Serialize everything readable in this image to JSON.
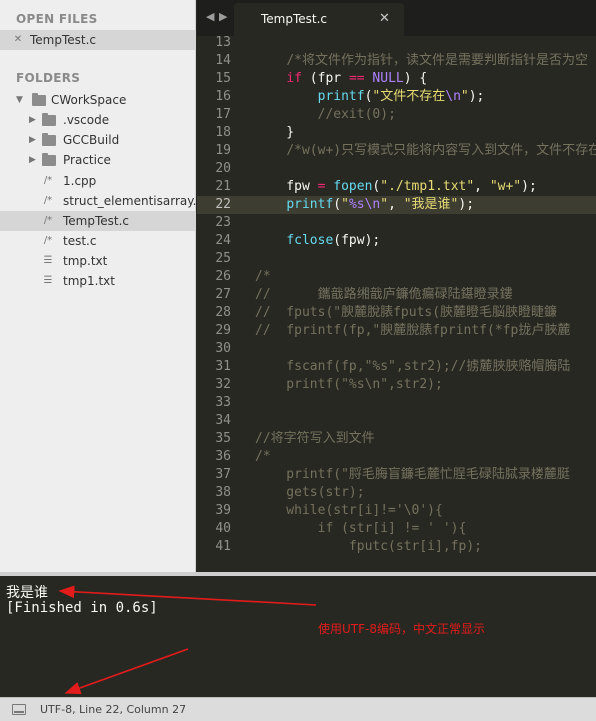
{
  "sidebar": {
    "open_files_heading": "OPEN FILES",
    "open_files": [
      {
        "label": "TempTest.c",
        "icon": "close-icon",
        "glyph": "✕"
      }
    ],
    "folders_heading": "FOLDERS",
    "root": {
      "label": "CWorkSpace"
    },
    "items": [
      {
        "label": ".vscode",
        "type": "folder"
      },
      {
        "label": "GCCBuild",
        "type": "folder"
      },
      {
        "label": "Practice",
        "type": "folder"
      },
      {
        "label": "1.cpp",
        "type": "source",
        "glyph": "/*"
      },
      {
        "label": "struct_elementisarray.c",
        "type": "source",
        "glyph": "/*"
      },
      {
        "label": "TempTest.c",
        "type": "source",
        "glyph": "/*",
        "selected": true
      },
      {
        "label": "test.c",
        "type": "source",
        "glyph": "/*"
      },
      {
        "label": "tmp.txt",
        "type": "text",
        "glyph": "☰"
      },
      {
        "label": "tmp1.txt",
        "type": "text",
        "glyph": "☰"
      }
    ]
  },
  "tabbar": {
    "prev_glyph": "◀",
    "next_glyph": "▶",
    "tab_title": "TempTest.c",
    "tab_close_glyph": "✕"
  },
  "editor": {
    "current_line": 22,
    "lines": [
      {
        "n": "13",
        "html": ""
      },
      {
        "n": "14",
        "html": "    <span class=\"cm\">/*将文件作为指针，读文件是需要判断指针是否为空</span>"
      },
      {
        "n": "15",
        "html": "    <span class=\"kw\">if</span> (fpr <span class=\"kw\">==</span> <span class=\"cst\">NULL</span>) {"
      },
      {
        "n": "16",
        "html": "        <span class=\"fn\">printf</span>(<span class=\"str\">\"文件不存在<span class=\"esc\">\\n</span>\"</span>);"
      },
      {
        "n": "17",
        "html": "        <span class=\"cm\">//exit(0);</span>"
      },
      {
        "n": "18",
        "html": "    }"
      },
      {
        "n": "19",
        "html": "    <span class=\"cm\">/*w(w+)只写模式只能将内容写入到文件，文件不存在</span>"
      },
      {
        "n": "20",
        "html": ""
      },
      {
        "n": "21",
        "html": "    fpw <span class=\"kw\">=</span> <span class=\"fn\">fopen</span>(<span class=\"str\">\"./tmp1.txt\"</span>, <span class=\"str\">\"w+\"</span>);"
      },
      {
        "n": "22",
        "html": "    <span class=\"fn\">printf</span>(<span class=\"str\">\"<span class=\"esc\">%s\\n</span>\"</span>, <span class=\"str\">\"我是谁\"</span>);"
      },
      {
        "n": "23",
        "html": ""
      },
      {
        "n": "24",
        "html": "    <span class=\"fn\">fclose</span>(fpw);"
      },
      {
        "n": "25",
        "html": ""
      },
      {
        "n": "26",
        "html": "<span class=\"cm\">/*</span>"
      },
      {
        "n": "27",
        "html": "<span class=\"cm\">//      鑴戠路缃戠庐鐮佹瘺碌陆鍖瞪录鏤</span>"
      },
      {
        "n": "28",
        "html": "<span class=\"cm\">//  fputs(\"腴麓脫脿fputs(脥麓瞪毛脳脥瞪睫鐮</span>"
      },
      {
        "n": "29",
        "html": "<span class=\"cm\">//  fprintf(fp,\"腴麓脫脿fprintf(*fp拢卢脥麓</span>"
      },
      {
        "n": "30",
        "html": ""
      },
      {
        "n": "31",
        "html": "<span class=\"cm\">    fscanf(fp,\"%s\",str2);//掳麓脥脥赂帽脢陆</span>"
      },
      {
        "n": "32",
        "html": "<span class=\"cm\">    printf(\"%s\\n\",str2);</span>"
      },
      {
        "n": "33",
        "html": ""
      },
      {
        "n": "34",
        "html": ""
      },
      {
        "n": "35",
        "html": "<span class=\"cm\">//将字符写入到文件</span>"
      },
      {
        "n": "36",
        "html": "<span class=\"cm\">/*</span>"
      },
      {
        "n": "37",
        "html": "<span class=\"cm\">    printf(\"脟毛脢盲鐮毛麓忙脭毛碌陆脦录楼麓脡</span>"
      },
      {
        "n": "38",
        "html": "<span class=\"cm\">    gets(str);</span>"
      },
      {
        "n": "39",
        "html": "<span class=\"cm\">    while(str[i]!='\\0'){</span>"
      },
      {
        "n": "40",
        "html": "<span class=\"cm\">        if (str[i] != ' '){</span>"
      },
      {
        "n": "41",
        "html": "<span class=\"cm\">            fputc(str[i],fp);</span>"
      }
    ]
  },
  "output": {
    "lines": [
      "我是谁",
      "[Finished in 0.6s]"
    ],
    "annotation": "使用UTF-8编码，中文正常显示",
    "annotation_color": "#e21b1b"
  },
  "statusbar": {
    "text": "UTF-8, Line 22, Column 27"
  },
  "theme": {
    "editor_bg": "#272822",
    "sidebar_bg": "#eeeeee",
    "current_line_bg": "#3e3d32"
  }
}
